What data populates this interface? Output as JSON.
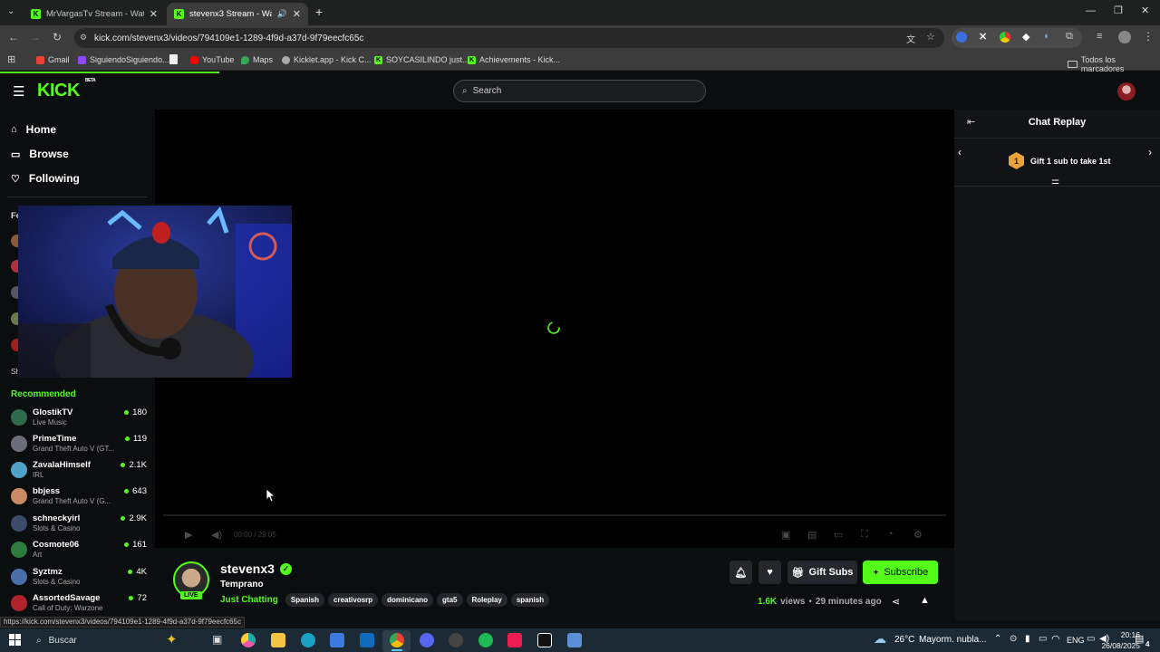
{
  "browser": {
    "tabs": [
      {
        "title": "MrVargasTv Stream - Watch Liv",
        "active": false
      },
      {
        "title": "stevenx3 Stream - Watch Li",
        "active": true
      }
    ],
    "url": "kick.com/stevenx3/videos/794109e1-1289-4f9d-a37d-9f79eecfc65c",
    "status_url": "https://kick.com/stevenx3/videos/794109e1-1289-4f9d-a37d-9f79eecfc65c",
    "bookmarks": [
      "Gmail",
      "SiguiendoSiguiendo...",
      "YouTube",
      "Maps",
      "Kicklet.app - Kick C...",
      "SOYCASILINDO just...",
      "Achievements - Kick..."
    ],
    "all_bookmarks": "Todos los marcadores"
  },
  "site": {
    "logo": "KICK",
    "logo_badge": "BETA",
    "search_placeholder": "Search",
    "nav": [
      "Home",
      "Browse",
      "Following"
    ],
    "following_header": "Fo",
    "show_more": "Sh",
    "recommended_title": "Recommended",
    "recommended": [
      {
        "name": "GlostikTV",
        "category": "Live Music",
        "viewers": "180",
        "color": "#2d6b4a"
      },
      {
        "name": "PrimeTime",
        "category": "Grand Theft Auto V (GT...",
        "viewers": "119",
        "color": "#6d6d7a"
      },
      {
        "name": "ZavalaHimself",
        "category": "IRL",
        "viewers": "2.1K",
        "color": "#4fa3c7"
      },
      {
        "name": "bbjess",
        "category": "Grand Theft Auto V (G...",
        "viewers": "643",
        "color": "#c98a66"
      },
      {
        "name": "schneckyirl",
        "category": "Slots & Casino",
        "viewers": "2.9K",
        "color": "#3a4b6c"
      },
      {
        "name": "Cosmote06",
        "category": "Art",
        "viewers": "161",
        "color": "#2f7a3d"
      },
      {
        "name": "Syztmz",
        "category": "Slots & Casino",
        "viewers": "4K",
        "color": "#4a6fa8"
      },
      {
        "name": "AssortedSavage",
        "category": "Call of Duty: Warzone",
        "viewers": "72",
        "color": "#b0232a"
      }
    ]
  },
  "player": {
    "time": "00:00 / 29:05",
    "progress": 0
  },
  "chat": {
    "title": "Chat Replay",
    "gift_rank": "1",
    "gift_text": "Gift 1 sub to take 1st"
  },
  "channel": {
    "name": "stevenx3",
    "live_badge": "LIVE",
    "stream_title": "Temprano",
    "category": "Just Chatting",
    "tags": [
      "Spanish",
      "creativosrp",
      "dominicano",
      "gta5",
      "Roleplay",
      "spanish"
    ],
    "gift_subs": "Gift Subs",
    "subscribe": "Subscribe",
    "views": "1.6K",
    "views_label": "views",
    "ago": "29 minutes ago"
  },
  "taskbar": {
    "search": "Buscar",
    "weather_temp": "26°C",
    "weather_text": "Mayorm. nubla...",
    "lang": "ENG",
    "time": "20:16",
    "date": "26/08/2025",
    "notifications": "4"
  }
}
